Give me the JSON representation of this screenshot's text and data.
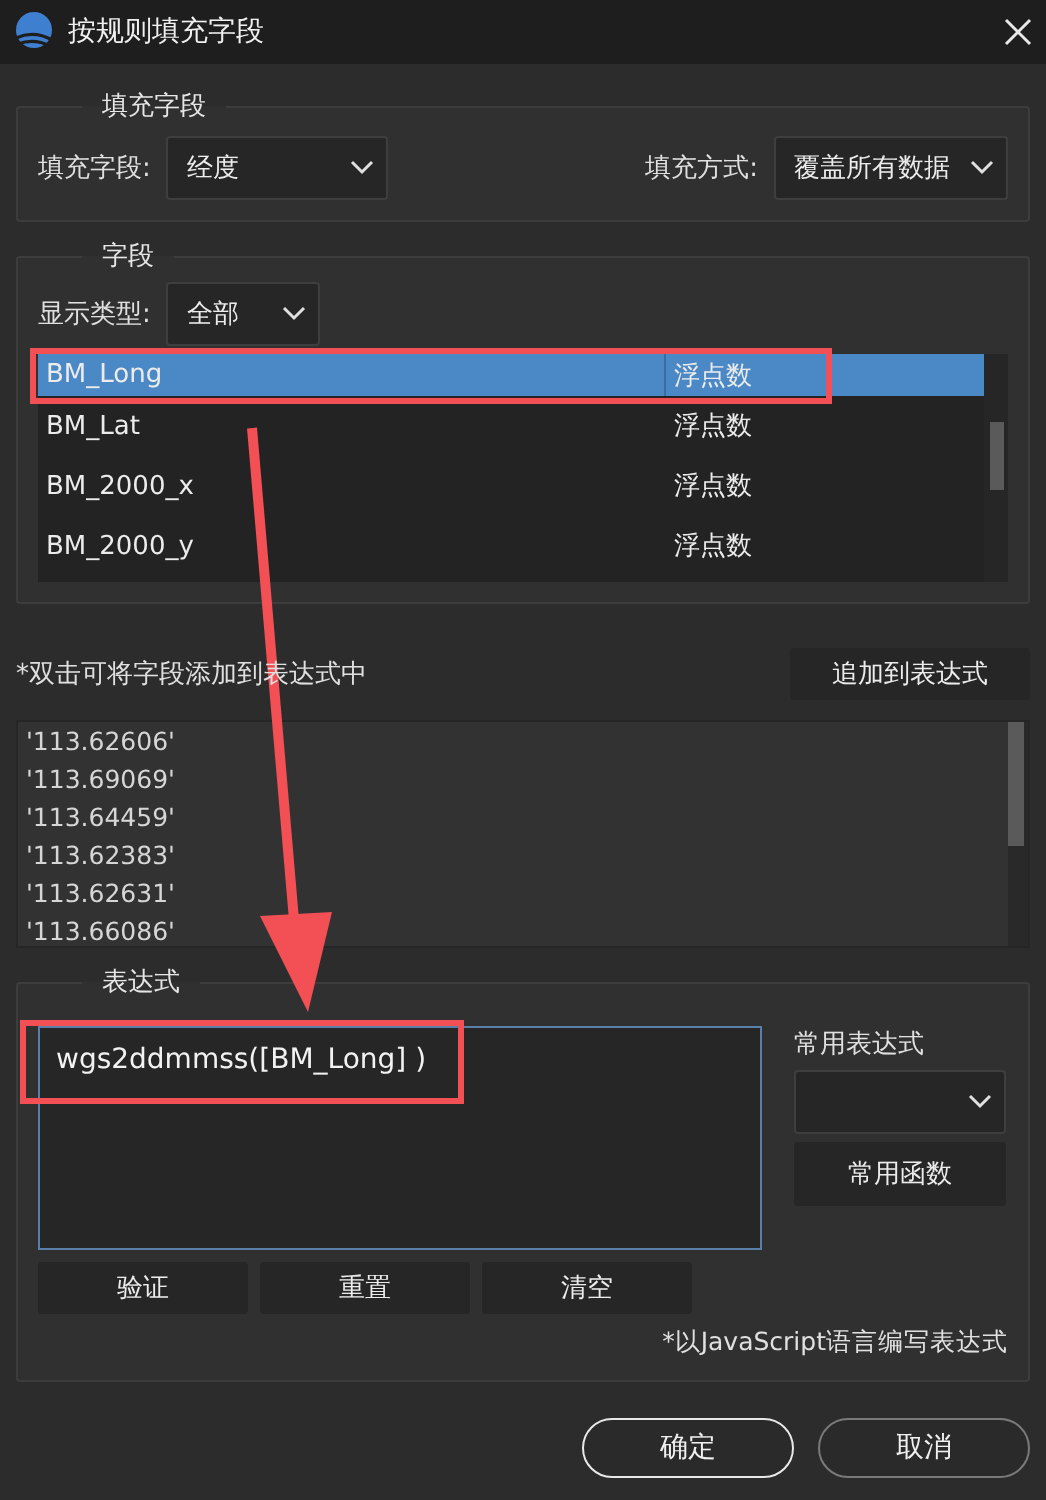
{
  "window": {
    "title": "按规则填充字段"
  },
  "fill_group": {
    "title": "填充字段",
    "fields": [
      {
        "label": "填充字段:",
        "value": "经度"
      },
      {
        "label": "填充方式:",
        "value": "覆盖所有数据"
      }
    ]
  },
  "fields_group": {
    "title": "字段",
    "filter": {
      "label": "显示类型:",
      "value": "全部"
    },
    "rows": [
      {
        "name": "BM_Long",
        "type": "浮点数",
        "selected": true
      },
      {
        "name": "BM_Lat",
        "type": "浮点数",
        "selected": false
      },
      {
        "name": "BM_2000_x",
        "type": "浮点数",
        "selected": false
      },
      {
        "name": "BM_2000_y",
        "type": "浮点数",
        "selected": false
      }
    ]
  },
  "hint": "*双击可将字段添加到表达式中",
  "add_button": "追加到表达式",
  "values": [
    "'113.62606'",
    "'113.69069'",
    "'113.64459'",
    "'113.62383'",
    "'113.62631'",
    "'113.66086'"
  ],
  "expression_group": {
    "title": "表达式",
    "expression": "wgs2ddmmss([BM_Long] )",
    "common_label": "常用表达式",
    "functions_button": "常用函数",
    "buttons": [
      "验证",
      "重置",
      "清空"
    ],
    "note": "*以JavaScript语言编写表达式"
  },
  "footer_buttons": [
    {
      "label": "确定",
      "kind": "primary"
    },
    {
      "label": "取消",
      "kind": "secondary"
    }
  ],
  "annotations": [
    {
      "kind": "box"
    },
    {
      "kind": "box"
    },
    {
      "kind": "arrow"
    }
  ]
}
